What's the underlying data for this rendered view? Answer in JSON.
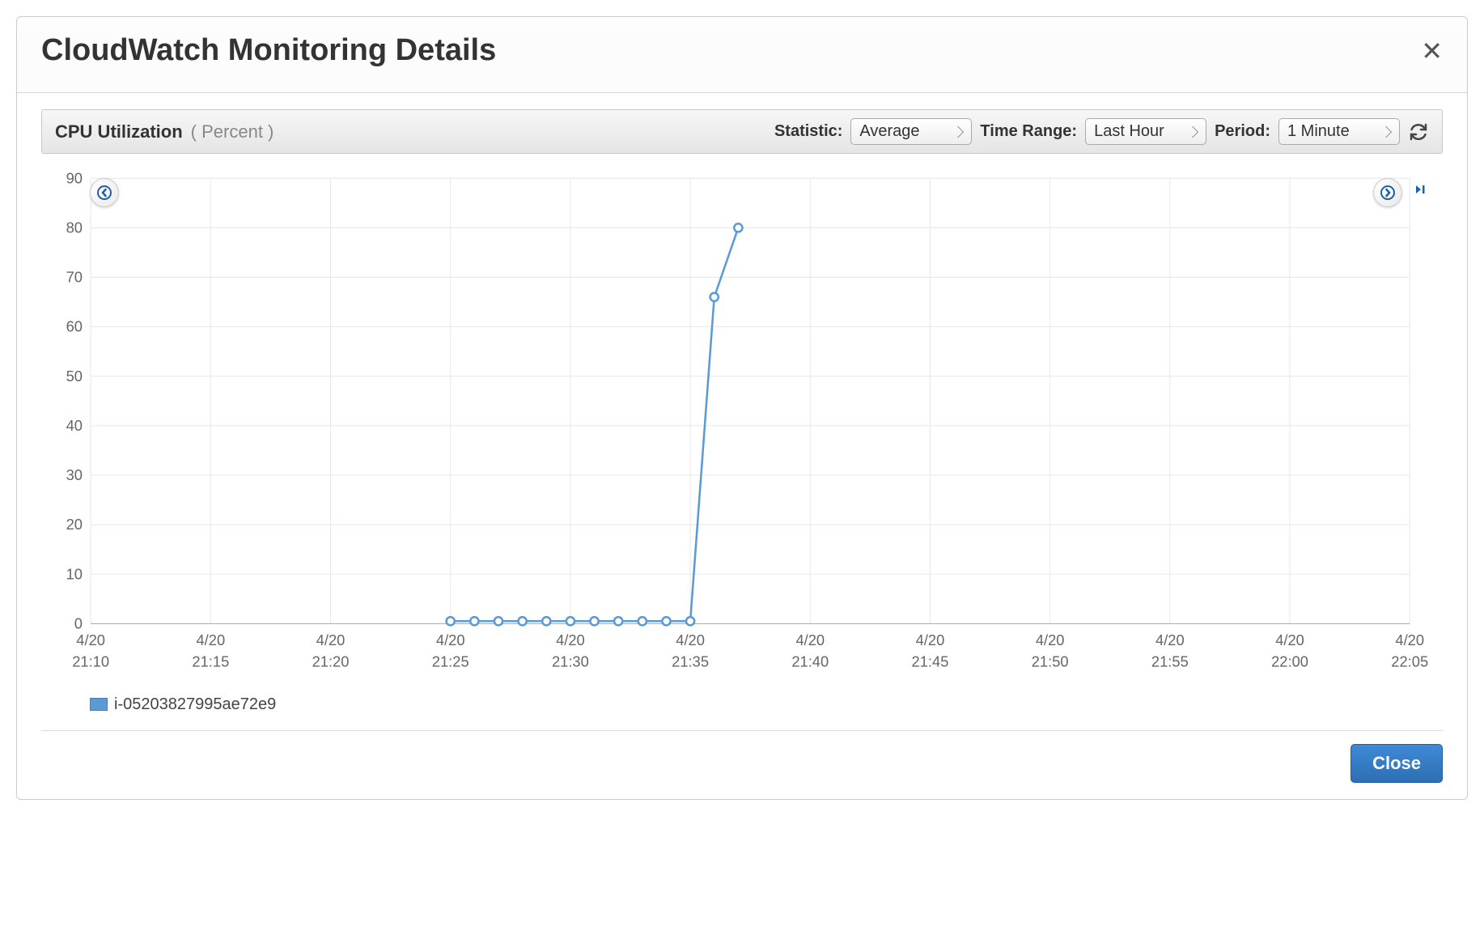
{
  "dialog": {
    "title": "CloudWatch Monitoring Details",
    "close_x": "✕"
  },
  "controls": {
    "metric_name": "CPU Utilization",
    "metric_unit": "( Percent )",
    "statistic_label": "Statistic:",
    "statistic_value": "Average",
    "timerange_label": "Time Range:",
    "timerange_value": "Last Hour",
    "period_label": "Period:",
    "period_value": "1 Minute"
  },
  "legend": {
    "series_name": "i-05203827995ae72e9"
  },
  "footer": {
    "close_label": "Close"
  },
  "chart_data": {
    "type": "line",
    "title": "CPU Utilization (Percent)",
    "xlabel": "",
    "ylabel": "",
    "ylim": [
      0,
      90
    ],
    "y_ticks": [
      0,
      10,
      20,
      30,
      40,
      50,
      60,
      70,
      80,
      90
    ],
    "x_ticks": [
      {
        "date": "4/20",
        "time": "21:10"
      },
      {
        "date": "4/20",
        "time": "21:15"
      },
      {
        "date": "4/20",
        "time": "21:20"
      },
      {
        "date": "4/20",
        "time": "21:25"
      },
      {
        "date": "4/20",
        "time": "21:30"
      },
      {
        "date": "4/20",
        "time": "21:35"
      },
      {
        "date": "4/20",
        "time": "21:40"
      },
      {
        "date": "4/20",
        "time": "21:45"
      },
      {
        "date": "4/20",
        "time": "21:50"
      },
      {
        "date": "4/20",
        "time": "21:55"
      },
      {
        "date": "4/20",
        "time": "22:00"
      },
      {
        "date": "4/20",
        "time": "22:05"
      }
    ],
    "series": [
      {
        "name": "i-05203827995ae72e9",
        "color": "#5b9bd5",
        "x": [
          "21:25",
          "21:26",
          "21:27",
          "21:28",
          "21:29",
          "21:30",
          "21:31",
          "21:32",
          "21:33",
          "21:34",
          "21:35",
          "21:36",
          "21:37"
        ],
        "values": [
          0.5,
          0.5,
          0.5,
          0.5,
          0.5,
          0.5,
          0.5,
          0.5,
          0.5,
          0.5,
          0.5,
          66,
          80
        ]
      }
    ]
  }
}
